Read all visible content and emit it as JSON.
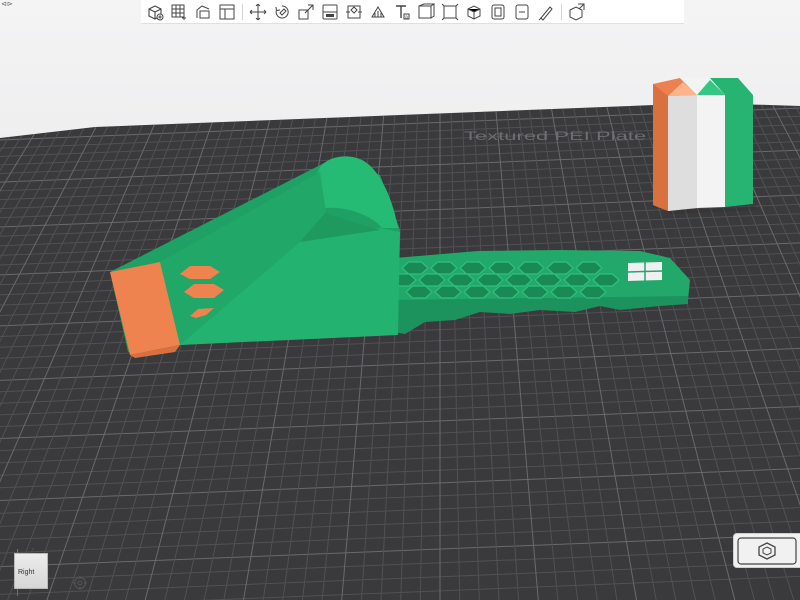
{
  "app": {
    "collapse_glyph": "⊲⊳"
  },
  "toolbar": {
    "items": [
      {
        "name": "add-object-icon"
      },
      {
        "name": "arrange-grid-icon"
      },
      {
        "name": "orient-icon"
      },
      {
        "name": "plate-layout-icon"
      },
      {
        "name": "split-sep-icon"
      },
      {
        "name": "move-icon"
      },
      {
        "name": "rotate-icon"
      },
      {
        "name": "scale-icon"
      },
      {
        "name": "lay-on-face-icon"
      },
      {
        "name": "cut-icon"
      },
      {
        "name": "support-paint-icon"
      },
      {
        "name": "text-icon"
      },
      {
        "name": "measure-icon"
      },
      {
        "name": "boolean-icon"
      },
      {
        "name": "assembly-icon"
      },
      {
        "name": "variable-layer-icon"
      },
      {
        "name": "seam-paint-icon"
      },
      {
        "name": "color-paint-icon"
      },
      {
        "name": "explode-icon"
      }
    ]
  },
  "scene": {
    "plate_label": "Textured PEI Plate",
    "colors": {
      "bed": "#3a3a3c",
      "grid_minor": "#515154",
      "grid_major": "#6a6a6d",
      "model_green": "#23b06f",
      "model_green_dark": "#1c8f5a",
      "model_orange": "#ee8350",
      "flag_white": "#ececec"
    }
  },
  "view_cube": {
    "label": "Right",
    "axis": "Z"
  }
}
